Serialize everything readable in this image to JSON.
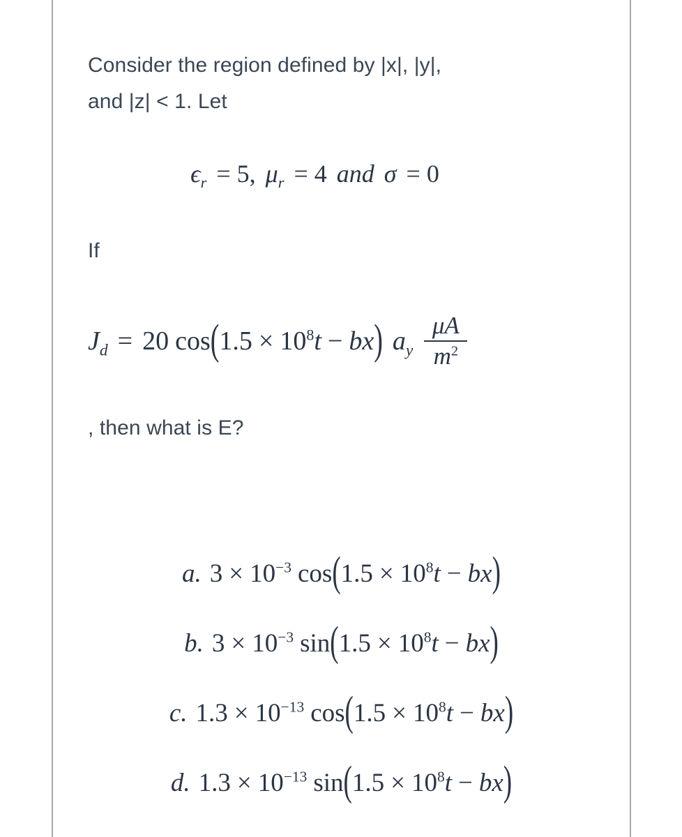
{
  "page": {
    "background": "#ffffff",
    "rule_color": "#a9a9ad",
    "prose_color": "#3b4654",
    "math_color": "#2b3544"
  },
  "question": {
    "line1": "Consider the region defined by |x|, |y|,",
    "line2": "and |z| < 1. Let",
    "if_word": "If",
    "then_line": ", then what is E?"
  },
  "parameters": {
    "epsilon_symbol": "ϵ",
    "epsilon_sub": "r",
    "equals": "=",
    "epsilon_value": "5",
    "comma": ",",
    "mu_symbol": "μ",
    "mu_sub": "r",
    "mu_value": "4",
    "and_word": "and",
    "sigma_symbol": "σ",
    "sigma_value": "0"
  },
  "jd_equation": {
    "lhs_symbol": "J",
    "lhs_sub": "d",
    "equals": "=",
    "coefficient": "20",
    "function": "cos",
    "paren_open": "(",
    "arg_mantissa": "1.5",
    "arg_times": "×",
    "arg_base": "10",
    "arg_exponent": "8",
    "arg_time": "t",
    "arg_minus": "−",
    "arg_phase": "bx",
    "paren_close": ")",
    "unit_vector": "a",
    "unit_vector_sub": "y",
    "units_numerator": "μA",
    "units_denominator_base": "m",
    "units_denominator_exp": "2"
  },
  "options": [
    {
      "label": "a.",
      "mantissa": "3",
      "times": "×",
      "base": "10",
      "exponent": "−3",
      "function": "cos",
      "paren_open": "(",
      "arg_mantissa": "1.5",
      "arg_times": "×",
      "arg_base": "10",
      "arg_exponent": "8",
      "arg_time": "t",
      "arg_minus": "−",
      "arg_phase": "bx",
      "paren_close": ")"
    },
    {
      "label": "b.",
      "mantissa": "3",
      "times": "×",
      "base": "10",
      "exponent": "−3",
      "function": "sin",
      "paren_open": "(",
      "arg_mantissa": "1.5",
      "arg_times": "×",
      "arg_base": "10",
      "arg_exponent": "8",
      "arg_time": "t",
      "arg_minus": "−",
      "arg_phase": "bx",
      "paren_close": ")"
    },
    {
      "label": "c.",
      "mantissa": "1.3",
      "times": "×",
      "base": "10",
      "exponent": "−13",
      "function": "cos",
      "paren_open": "(",
      "arg_mantissa": "1.5",
      "arg_times": "×",
      "arg_base": "10",
      "arg_exponent": "8",
      "arg_time": "t",
      "arg_minus": "−",
      "arg_phase": "bx",
      "paren_close": ")"
    },
    {
      "label": "d.",
      "mantissa": "1.3",
      "times": "×",
      "base": "10",
      "exponent": "−13",
      "function": "sin",
      "paren_open": "(",
      "arg_mantissa": "1.5",
      "arg_times": "×",
      "arg_base": "10",
      "arg_exponent": "8",
      "arg_time": "t",
      "arg_minus": "−",
      "arg_phase": "bx",
      "paren_close": ")"
    }
  ]
}
